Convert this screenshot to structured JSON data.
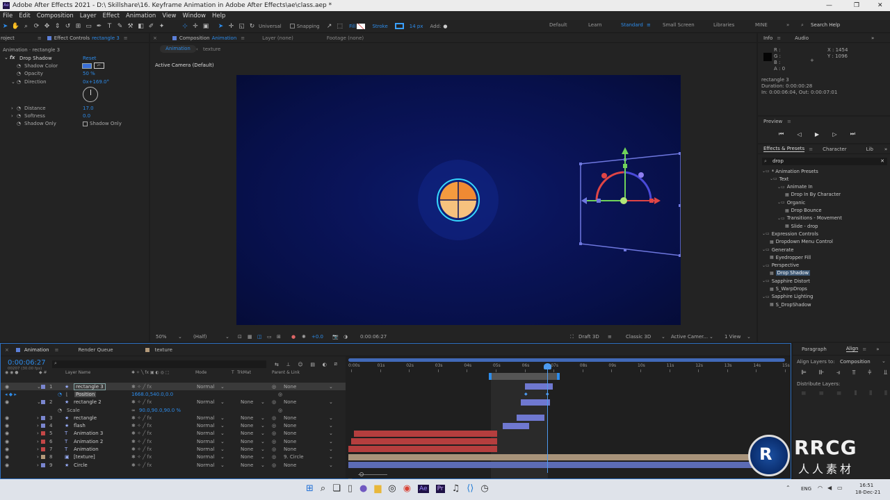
{
  "window": {
    "title": "Adobe After Effects 2021 - D:\\ Skillshare\\16. Keyframe Animation in Adobe After Effects\\ae\\class.aep *",
    "controls": [
      "—",
      "❐",
      "✕"
    ]
  },
  "menu": [
    "File",
    "Edit",
    "Composition",
    "Layer",
    "Effect",
    "Animation",
    "View",
    "Window",
    "Help"
  ],
  "toolbar": {
    "universal": "Universal",
    "snapping": "Snapping",
    "fill": "Fill",
    "stroke": "Stroke",
    "stroke_width": "14 px",
    "add": "Add:",
    "workspaces": [
      "Default",
      "Learn",
      "Standard",
      "Small Screen",
      "Libraries",
      "MINE"
    ],
    "search": "Search Help"
  },
  "effect_controls": {
    "tab_project": "roject",
    "tab_label": "Effect Controls",
    "tab_layer": "rectangle 3",
    "header": "Animation · rectangle 3",
    "effect": "Drop Shadow",
    "reset": "Reset",
    "props": [
      {
        "name": "Shadow Color",
        "value": ""
      },
      {
        "name": "Opacity",
        "value": "50 %"
      },
      {
        "name": "Direction",
        "value": "0x+169.0°"
      },
      {
        "name": "Distance",
        "value": "17.0"
      },
      {
        "name": "Softness",
        "value": "0.0"
      },
      {
        "name": "Shadow Only",
        "value": "Shadow Only"
      }
    ]
  },
  "composition": {
    "tab_label": "Composition",
    "tab_name": "Animation",
    "layer_tab": "Layer (none)",
    "footage_tab": "Footage (none)",
    "sub_tabs": [
      "Animation",
      "texture"
    ],
    "camera_label": "Active Camera (Default)",
    "footer": {
      "zoom": "50%",
      "resolution": "(Half)",
      "exposure": "+0.0",
      "time": "0:00:06:27",
      "draft": "Draft 3D",
      "renderer": "Classic 3D",
      "camera": "Active Camer...",
      "views": "1 View"
    }
  },
  "info": {
    "tab": "Info",
    "audio_tab": "Audio",
    "r": "R :",
    "g": "G :",
    "b": "B :",
    "a": "A :  0",
    "x": "X : 1454",
    "y": "Y : 1096",
    "layer": "rectangle 3",
    "duration": "Duration: 0:00:00:28",
    "inout": "In: 0:00:06:04, Out: 0:00:07:01"
  },
  "preview": {
    "label": "Preview"
  },
  "effects_presets": {
    "tab": "Effects & Presets",
    "char_tab": "Character",
    "lib_tab": "Lib",
    "search": "drop",
    "tree": [
      {
        "label": "* Animation Presets",
        "d": 0
      },
      {
        "label": "Text",
        "d": 1
      },
      {
        "label": "Animate In",
        "d": 2
      },
      {
        "label": "Drop In By Character",
        "d": 3
      },
      {
        "label": "Organic",
        "d": 2
      },
      {
        "label": "Drop Bounce",
        "d": 3
      },
      {
        "label": "Transitions - Movement",
        "d": 2
      },
      {
        "label": "Slide - drop",
        "d": 3
      },
      {
        "label": "Expression Controls",
        "d": 0
      },
      {
        "label": "Dropdown Menu Control",
        "d": 1
      },
      {
        "label": "Generate",
        "d": 0
      },
      {
        "label": "Eyedropper Fill",
        "d": 1
      },
      {
        "label": "Perspective",
        "d": 0
      },
      {
        "label": "Drop Shadow",
        "d": 1,
        "sel": true
      },
      {
        "label": "Sapphire Distort",
        "d": 0
      },
      {
        "label": "S_WarpDrops",
        "d": 1
      },
      {
        "label": "Sapphire Lighting",
        "d": 0
      },
      {
        "label": "S_DropShadow",
        "d": 1
      }
    ]
  },
  "timeline": {
    "tabs": [
      "Animation",
      "Render Queue",
      "texture"
    ],
    "timecode": "0:00:06:27",
    "fps": "00207 (30.00 fps)",
    "columns": {
      "name": "Layer Name",
      "mode": "Mode",
      "t": "T",
      "trkmat": "TrkMat",
      "parent": "Parent & Link"
    },
    "ruler": [
      "0:00s",
      "01s",
      "02s",
      "03s",
      "04s",
      "05s",
      "06s",
      "07s",
      "08s",
      "09s",
      "10s",
      "11s",
      "12s",
      "13s",
      "14s",
      "15s"
    ],
    "layers": [
      {
        "n": "1",
        "name": "rectangle 3",
        "mode": "Normal",
        "trk": "",
        "parent": "None",
        "color": "#7a86cf",
        "sel": true
      },
      {
        "n": "",
        "name": "Position",
        "value": "1668.0,540.0,0.0",
        "sub": true
      },
      {
        "n": "2",
        "name": "rectangle 2",
        "mode": "Normal",
        "trk": "None",
        "parent": "None",
        "color": "#7a86cf"
      },
      {
        "n": "",
        "name": "Scale",
        "value": "90.0,90.0,90.0 %",
        "sub": true
      },
      {
        "n": "3",
        "name": "rectangle",
        "mode": "Normal",
        "trk": "None",
        "parent": "None",
        "color": "#7a86cf"
      },
      {
        "n": "4",
        "name": "flash",
        "mode": "Normal",
        "trk": "None",
        "parent": "None",
        "color": "#7a86cf"
      },
      {
        "n": "5",
        "name": "Animation 3",
        "mode": "Normal",
        "trk": "None",
        "parent": "None",
        "color": "#c44747"
      },
      {
        "n": "6",
        "name": "Animation 2",
        "mode": "Normal",
        "trk": "None",
        "parent": "None",
        "color": "#c44747"
      },
      {
        "n": "7",
        "name": "Animation",
        "mode": "Normal",
        "trk": "None",
        "parent": "None",
        "color": "#c44747"
      },
      {
        "n": "8",
        "name": "[texture]",
        "mode": "Normal",
        "trk": "None",
        "parent": "9. Circle",
        "color": "#b49a7a"
      },
      {
        "n": "9",
        "name": "Circle",
        "mode": "Normal",
        "trk": "None",
        "parent": "None",
        "color": "#7a86cf"
      }
    ]
  },
  "paragraph": {
    "tab": "Paragraph",
    "align_tab": "Align",
    "align_to": "Align Layers to:",
    "align_value": "Composition",
    "distribute": "Distribute Layers:"
  },
  "taskbar": {
    "time": "16:51",
    "date": "18-Dec-21",
    "lang": "ENG"
  },
  "watermark": {
    "brand": "RRCG",
    "sub": "人人素材"
  },
  "colors": {
    "accent": "#2d8ceb",
    "viewer_bg": "#07104a"
  }
}
